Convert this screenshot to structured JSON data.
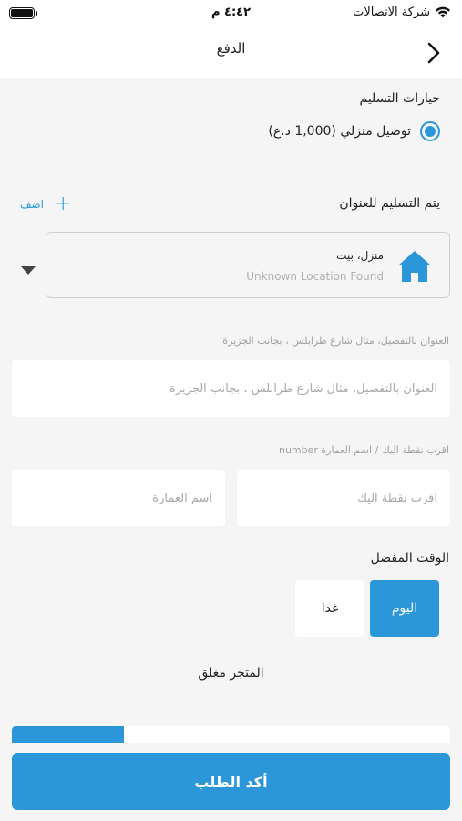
{
  "status_bar": {
    "carrier": "شركة الاتصالات",
    "time": "٤:٤٢ م"
  },
  "nav": {
    "title": "الدفع"
  },
  "delivery_options": {
    "heading": "خيارات التسليم",
    "selected_option": "توصيل منزلي  (1,000 د.ع)"
  },
  "address": {
    "heading": "يتم التسليم للعنوان",
    "add_label": "اضف",
    "card_name": "منزل، بيت",
    "card_location": "Unknown Location Found",
    "detail_caption": "العنوان بالتفصيل، مثال شارع طرابلس ، بجانب الجزيرة",
    "detail_placeholder": "العنوان بالتفصيل، مثال شارع طرابلس ، بجانب الجزيرة",
    "landmark_caption": "اقرب نقطة اليك  /  اسم العمارة number",
    "landmark_placeholder": "اقرب نقطة اليك",
    "building_placeholder": "اسم العمارة"
  },
  "preferred_time": {
    "heading": "الوقت المفضل",
    "options": [
      "اليوم",
      "غدا"
    ],
    "selected": "اليوم"
  },
  "store_status": "المتجر مغلق",
  "progress": {
    "fraction": 0.255
  },
  "confirm_label": "أكد الطلب",
  "colors": {
    "accent": "#2b97d9",
    "background": "#f5f5f5"
  }
}
